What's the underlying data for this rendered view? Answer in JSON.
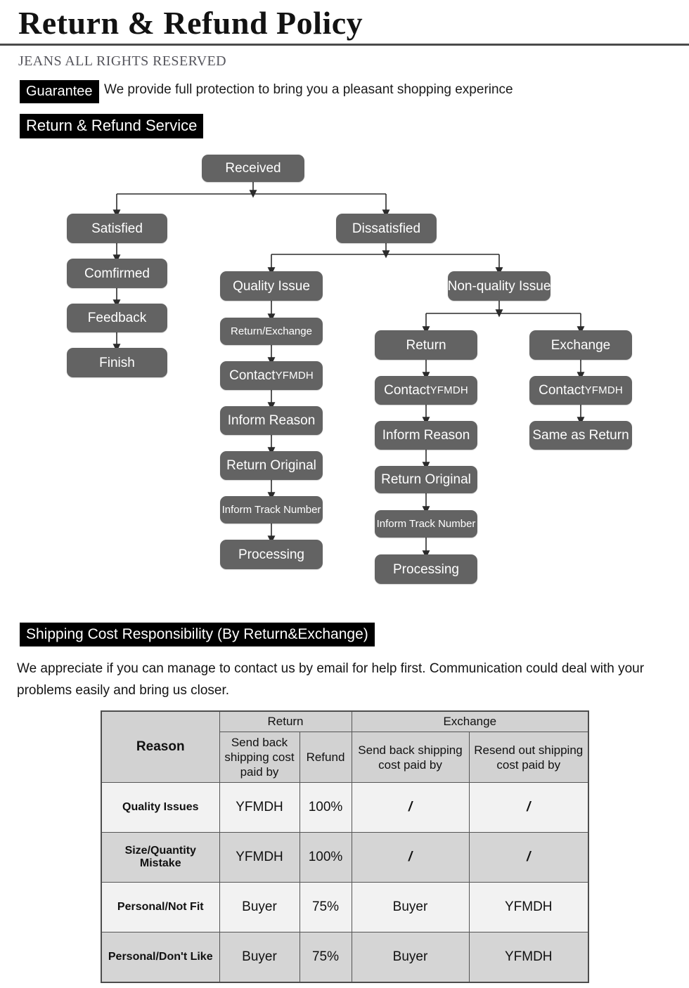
{
  "header": {
    "title": "Return & Refund Policy",
    "rights": "JEANS ALL RIGHTS RESERVED",
    "guarantee_badge": "Guarantee",
    "guarantee_text": "We provide full protection to bring you a pleasant shopping experince",
    "service_badge": "Return & Refund Service"
  },
  "flowchart": {
    "root": "Received",
    "satisfied": {
      "label": "Satisfied",
      "steps": [
        "Comfirmed",
        "Feedback",
        "Finish"
      ]
    },
    "dissatisfied": {
      "label": "Dissatisfied",
      "quality_issue": {
        "label": "Quality Issue",
        "steps": [
          "Return/Exchange",
          "Contact ",
          "Inform Reason",
          "Return Original",
          "Inform Track Number",
          "Processing"
        ]
      },
      "non_quality_issue": {
        "label": "Non-quality Issue",
        "return": {
          "label": "Return",
          "steps": [
            "Contact ",
            "Inform Reason",
            "Return Original",
            "Inform Track Number",
            "Processing"
          ]
        },
        "exchange": {
          "label": "Exchange",
          "steps": [
            "Contact ",
            "Same as Return"
          ]
        }
      }
    },
    "brand": "YFMDH"
  },
  "shipping": {
    "badge": "Shipping Cost Responsibility (By Return&Exchange)",
    "paragraph": "We appreciate if you can manage to contact us by email for help first. Communication could deal with your problems easily and bring us closer."
  },
  "cost_table": {
    "group_headers": {
      "reason": "Reason",
      "return": "Return",
      "exchange": "Exchange"
    },
    "sub_headers": [
      "Send back shipping cost paid by",
      "Refund",
      "Send back shipping cost paid by",
      "Resend out shipping cost paid by"
    ],
    "rows": [
      {
        "reason": "Quality Issues",
        "return_send_back": "YFMDH",
        "refund": "100%",
        "exchange_send_back": "/",
        "exchange_resend_out": "/"
      },
      {
        "reason": "Size/Quantity Mistake",
        "return_send_back": "YFMDH",
        "refund": "100%",
        "exchange_send_back": "/",
        "exchange_resend_out": "/"
      },
      {
        "reason": "Personal/Not Fit",
        "return_send_back": "Buyer",
        "refund": "75%",
        "exchange_send_back": "Buyer",
        "exchange_resend_out": "YFMDH"
      },
      {
        "reason": "Personal/Don't Like",
        "return_send_back": "Buyer",
        "refund": "75%",
        "exchange_send_back": "Buyer",
        "exchange_resend_out": "YFMDH"
      }
    ]
  },
  "colors": {
    "node_fill": "#636363",
    "badge_fill": "#000000",
    "table_header_fill": "#d2d2d2",
    "row_light": "#f2f2f2",
    "row_dark": "#d5d5d5",
    "rule": "#4a4a4a"
  }
}
